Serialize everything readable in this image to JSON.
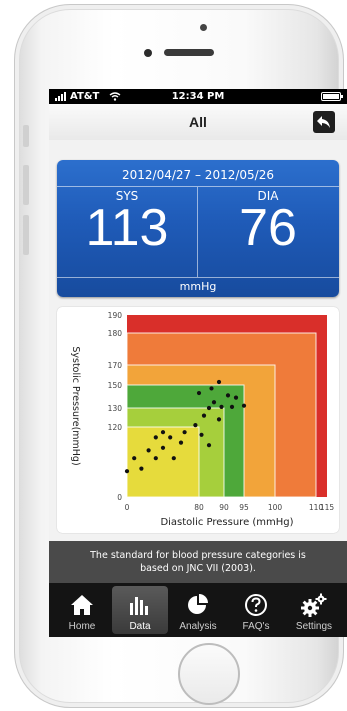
{
  "status_bar": {
    "carrier": "AT&T",
    "time": "12:34 PM"
  },
  "nav": {
    "title": "All",
    "back_icon": "back-arrow-icon"
  },
  "readout": {
    "date_range": "2012/04/27 – 2012/05/26",
    "sys_label": "SYS",
    "dia_label": "DIA",
    "sys_value": "113",
    "dia_value": "76",
    "unit": "mmHg",
    "panel_color": "#1f5bb8"
  },
  "chart_data": {
    "type": "scatter",
    "xlabel": "Diastolic Pressure (mmHg)",
    "ylabel": "Systolic Pressure(mmHg)",
    "x_ticks": [
      "0",
      "80",
      "90",
      "95",
      "100",
      "110",
      "115"
    ],
    "y_ticks": [
      "0",
      "120",
      "130",
      "150",
      "170",
      "180",
      "190"
    ],
    "zones": [
      {
        "max_dia": 115,
        "max_sys": 190,
        "color": "#d92f2a"
      },
      {
        "max_dia": 110,
        "max_sys": 180,
        "color": "#ef7b3a"
      },
      {
        "max_dia": 100,
        "max_sys": 170,
        "color": "#f2a43a"
      },
      {
        "max_dia": 95,
        "max_sys": 150,
        "color": "#4ea83a"
      },
      {
        "max_dia": 90,
        "max_sys": 130,
        "color": "#a6cf3c"
      },
      {
        "max_dia": 80,
        "max_sys": 120,
        "color": "#e6db3c"
      }
    ],
    "points": [
      {
        "dia": 60,
        "sys": 103
      },
      {
        "dia": 64,
        "sys": 104
      },
      {
        "dia": 62,
        "sys": 108
      },
      {
        "dia": 68,
        "sys": 108
      },
      {
        "dia": 66,
        "sys": 111
      },
      {
        "dia": 73,
        "sys": 108
      },
      {
        "dia": 70,
        "sys": 112
      },
      {
        "dia": 68,
        "sys": 116
      },
      {
        "dia": 72,
        "sys": 116
      },
      {
        "dia": 75,
        "sys": 114
      },
      {
        "dia": 70,
        "sys": 118
      },
      {
        "dia": 76,
        "sys": 118
      },
      {
        "dia": 84,
        "sys": 113
      },
      {
        "dia": 81,
        "sys": 117
      },
      {
        "dia": 79,
        "sys": 121
      },
      {
        "dia": 82,
        "sys": 126
      },
      {
        "dia": 88,
        "sys": 124
      },
      {
        "dia": 84,
        "sys": 130
      },
      {
        "dia": 89,
        "sys": 131
      },
      {
        "dia": 92,
        "sys": 131
      },
      {
        "dia": 95,
        "sys": 132
      },
      {
        "dia": 86,
        "sys": 135
      },
      {
        "dia": 91,
        "sys": 141
      },
      {
        "dia": 80,
        "sys": 143
      },
      {
        "dia": 85,
        "sys": 147
      },
      {
        "dia": 88,
        "sys": 153
      },
      {
        "dia": 93,
        "sys": 139
      }
    ]
  },
  "info": {
    "text": "The standard for blood pressure categories is based on JNC VII (2003)."
  },
  "tabs": [
    {
      "label": "Home",
      "icon": "home-icon",
      "active": false
    },
    {
      "label": "Data",
      "icon": "bar-chart-icon",
      "active": true
    },
    {
      "label": "Analysis",
      "icon": "pie-chart-icon",
      "active": false
    },
    {
      "label": "FAQ's",
      "icon": "question-icon",
      "active": false
    },
    {
      "label": "Settings",
      "icon": "gears-icon",
      "active": false
    }
  ]
}
